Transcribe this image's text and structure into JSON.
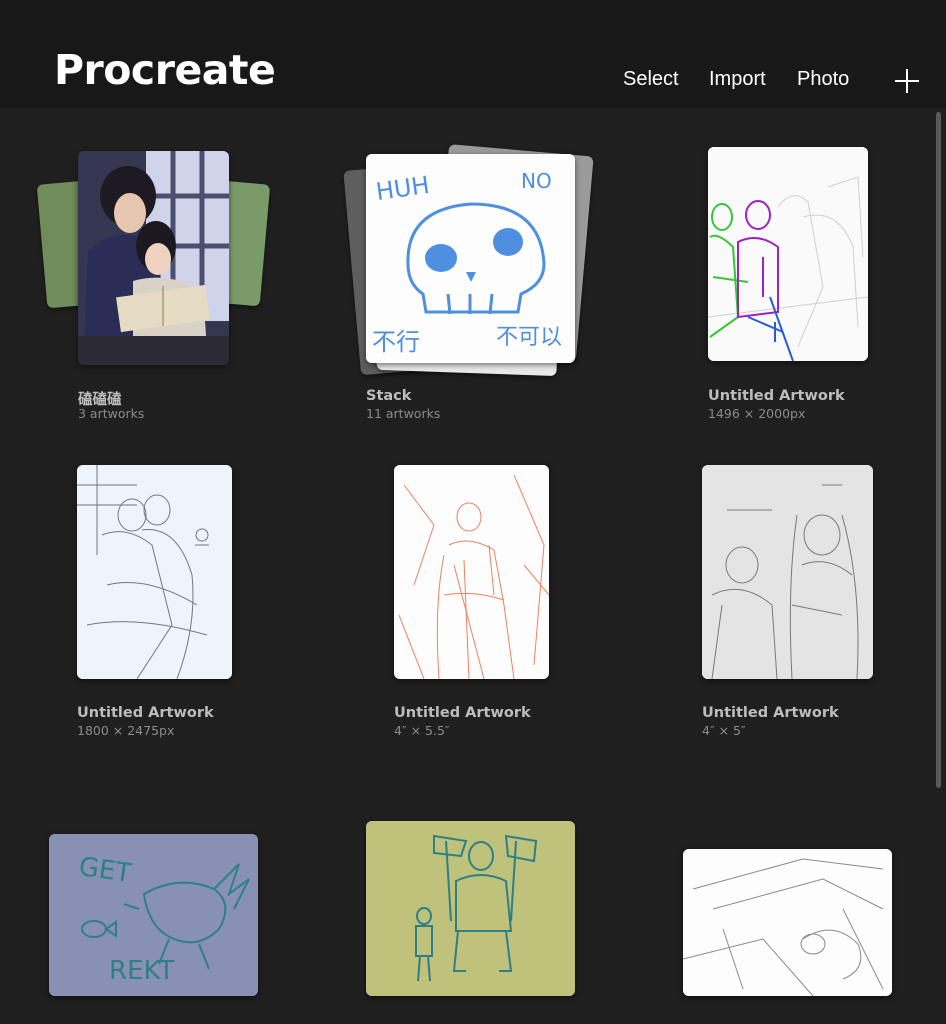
{
  "header": {
    "title": "Procreate",
    "select_label": "Select",
    "import_label": "Import",
    "photo_label": "Photo"
  },
  "gallery": {
    "items": [
      {
        "title": "磕磕磕",
        "subtitle": "3 artworks"
      },
      {
        "title": "Stack",
        "subtitle": "11 artworks"
      },
      {
        "title": "Untitled Artwork",
        "subtitle": "1496 × 2000px"
      },
      {
        "title": "Untitled Artwork",
        "subtitle": "1800 × 2475px"
      },
      {
        "title": "Untitled Artwork",
        "subtitle": "4″ × 5.5″"
      },
      {
        "title": "Untitled Artwork",
        "subtitle": "4″ × 5″"
      }
    ],
    "artwork_text": {
      "huh": "HUH",
      "no": "NO",
      "buxing": "不行",
      "bukeyi": "不可以",
      "get": "GET",
      "rekt": "REKT"
    }
  },
  "colors": {
    "background": "#1f1f1f",
    "topbar": "#181818",
    "accent_blue": "#4f8fe0",
    "purple_card": "#8891b3",
    "olive_card": "#bfc27a"
  }
}
